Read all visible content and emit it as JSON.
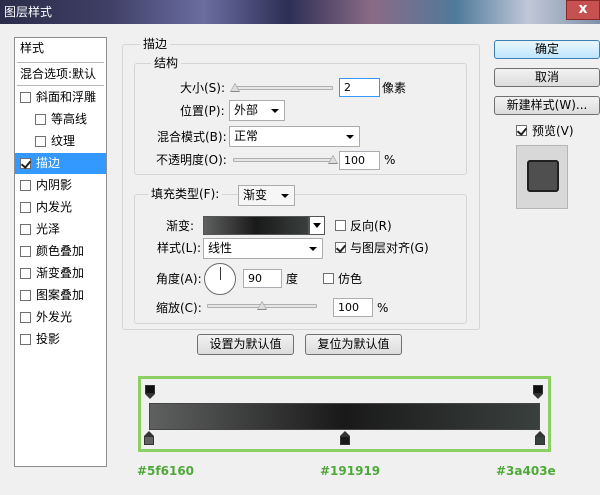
{
  "window": {
    "title": "图层样式",
    "close_label": "x"
  },
  "sidebar": {
    "header": "样式",
    "blend_options": "混合选项:默认",
    "items": [
      {
        "label": "斜面和浮雕",
        "checked": false
      },
      {
        "label": "等高线",
        "checked": false
      },
      {
        "label": "纹理",
        "checked": false
      },
      {
        "label": "描边",
        "checked": true
      },
      {
        "label": "内阴影",
        "checked": false
      },
      {
        "label": "内发光",
        "checked": false
      },
      {
        "label": "光泽",
        "checked": false
      },
      {
        "label": "颜色叠加",
        "checked": false
      },
      {
        "label": "渐变叠加",
        "checked": false
      },
      {
        "label": "图案叠加",
        "checked": false
      },
      {
        "label": "外发光",
        "checked": false
      },
      {
        "label": "投影",
        "checked": false
      }
    ]
  },
  "stroke": {
    "section_title": "描边",
    "structure_title": "结构",
    "size": {
      "label": "大小(S):",
      "value": "2",
      "unit": "像素",
      "slider_fraction": 0.02
    },
    "position": {
      "label": "位置(P):",
      "value": "外部"
    },
    "blend_mode": {
      "label": "混合模式(B):",
      "value": "正常"
    },
    "opacity": {
      "label": "不透明度(O):",
      "value": "100",
      "unit": "%",
      "slider_fraction": 1.0
    }
  },
  "fill": {
    "fill_type_label": "填充类型(F):",
    "fill_type_value": "渐变",
    "gradient_label": "渐变:",
    "reverse_label": "反向(R)",
    "reverse_checked": false,
    "style_label": "样式(L):",
    "style_value": "线性",
    "align_label": "与图层对齐(G)",
    "align_checked": true,
    "angle_label": "角度(A):",
    "angle_value": "90",
    "angle_unit": "度",
    "dither_label": "仿色",
    "dither_checked": false,
    "scale_label": "缩放(C):",
    "scale_value": "100",
    "scale_unit": "%",
    "scale_slider_fraction": 0.5
  },
  "buttons": {
    "set_default": "设置为默认值",
    "reset_default": "复位为默认值",
    "ok": "确定",
    "cancel": "取消",
    "new_style": "新建样式(W)...",
    "preview_label": "预览(V)",
    "preview_checked": true
  },
  "gradient_editor": {
    "stops": [
      {
        "hex": "#5f6160",
        "location_fraction": 0.0
      },
      {
        "hex": "#191919",
        "location_fraction": 0.5
      },
      {
        "hex": "#3a403e",
        "location_fraction": 1.0
      }
    ]
  },
  "colors": {
    "selected_row": "#3399ff",
    "annotation_green": "#4fa83a",
    "frame_green": "#8cd063"
  }
}
